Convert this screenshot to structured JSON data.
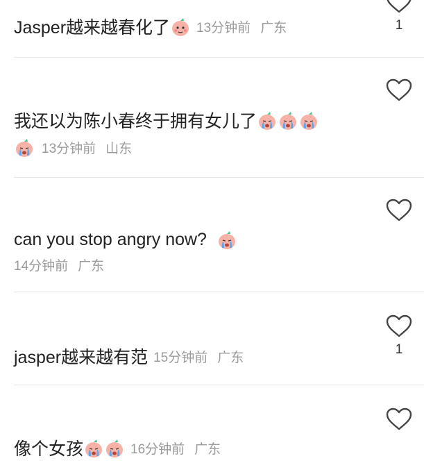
{
  "comments": [
    {
      "username": "",
      "text": "Jasper越来越春化了",
      "emoji": "peach-cheeky-emoji",
      "time": "13分钟前",
      "location": "广东",
      "likes": "1"
    },
    {
      "username": "",
      "text": "我还以为陈小春终于拥有女儿了",
      "emoji": "peach-crying-emoji",
      "time": "13分钟前",
      "location": "山东",
      "likes": ""
    },
    {
      "username": "",
      "text": "can you stop angry now?",
      "emoji": "peach-crying-emoji",
      "time": "14分钟前",
      "location": "广东",
      "likes": ""
    },
    {
      "username": "",
      "text": "jasper越来越有范",
      "time": "15分钟前",
      "location": "广东",
      "likes": "1"
    },
    {
      "username": "",
      "text": "像个女孩",
      "emoji": "peach-crying-emoji",
      "time": "16分钟前",
      "location": "广东",
      "likes": ""
    }
  ],
  "colors": {
    "text": "#222222",
    "meta": "#9a9a9a",
    "divider": "#e6e6e6",
    "peach": "#f6b2a6",
    "leaf": "#4cc38a",
    "tear": "#5aa8f0"
  }
}
